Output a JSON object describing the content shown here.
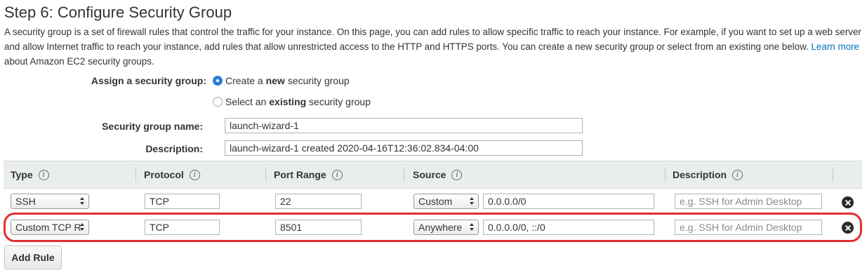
{
  "page": {
    "title": "Step 6: Configure Security Group",
    "intro_text": "A security group is a set of firewall rules that control the traffic for your instance. On this page, you can add rules to allow specific traffic to reach your instance. For example, if you want to set up a web server and allow Internet traffic to reach your instance, add rules that allow unrestricted access to the HTTP and HTTPS ports. You can create a new security group or select from an existing one below.",
    "learn_more_link": "Learn more",
    "intro_suffix": "about Amazon EC2 security groups."
  },
  "assign": {
    "label": "Assign a security group:",
    "options": [
      {
        "prefix": "Create a ",
        "bold": "new",
        "suffix": " security group",
        "checked": true
      },
      {
        "prefix": "Select an ",
        "bold": "existing",
        "suffix": " security group",
        "checked": false
      }
    ]
  },
  "group_name": {
    "label": "Security group name:",
    "value": "launch-wizard-1"
  },
  "group_description": {
    "label": "Description:",
    "value": "launch-wizard-1 created 2020-04-16T12:36:02.834-04:00"
  },
  "table": {
    "columns": [
      "Type",
      "Protocol",
      "Port Range",
      "Source",
      "Description"
    ],
    "info_glyph": "i",
    "rows": [
      {
        "type": "SSH",
        "protocol": "TCP",
        "port_range": "22",
        "source_select": "Custom",
        "source_cidr": "0.0.0.0/0",
        "description_placeholder": "e.g. SSH for Admin Desktop"
      },
      {
        "type": "Custom TCP R",
        "protocol": "TCP",
        "port_range": "8501",
        "source_select": "Anywhere",
        "source_cidr": "0.0.0.0/0, ::/0",
        "description_placeholder": "e.g. SSH for Admin Desktop"
      }
    ]
  },
  "add_rule_label": "Add Rule",
  "colors": {
    "link": "#0073bb",
    "header_bg": "#eaeded",
    "highlight": "#e0302f",
    "radio_checked": "#2f7dd8"
  }
}
